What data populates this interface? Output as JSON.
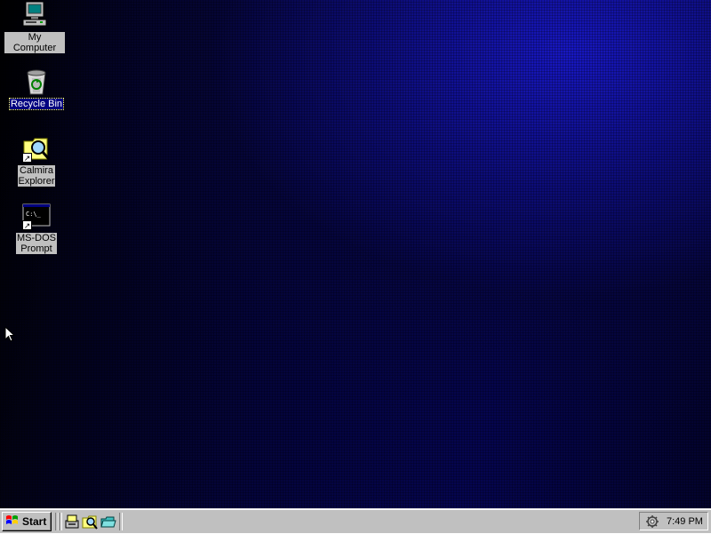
{
  "desktop": {
    "icons": [
      {
        "label": "My Computer",
        "icon": "my-computer-icon"
      },
      {
        "label": "Recycle Bin",
        "icon": "recycle-bin-icon",
        "selected": true
      },
      {
        "label": "Calmira\nExplorer",
        "icon": "calmira-explorer-icon",
        "shortcut": true
      },
      {
        "label": "MS-DOS\nPrompt",
        "icon": "ms-dos-prompt-icon",
        "shortcut": true,
        "screen_text": "C:\\_"
      }
    ],
    "colors": {
      "gradient_light": "#1818c8",
      "gradient_dark": "#000000",
      "label_bg": "#c0c0c0",
      "selected_bg": "#000080"
    }
  },
  "taskbar": {
    "start_label": "Start",
    "quick_launch": [
      "show-desktop-icon",
      "explore-icon",
      "folder-icon"
    ],
    "tray": {
      "clock": "7:49 PM",
      "icons": [
        "settings-gear-icon"
      ]
    },
    "color": "#c0c0c0"
  }
}
